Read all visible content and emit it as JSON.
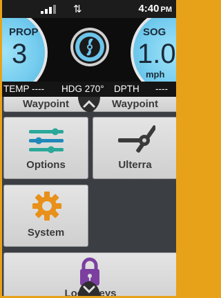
{
  "status": {
    "time": "4:40",
    "ampm": "PM"
  },
  "gauges": {
    "prop": {
      "label": "PROP",
      "value": "3"
    },
    "sog": {
      "label": "SOG",
      "value": "1.0",
      "unit": "mph"
    }
  },
  "info": {
    "temp": "TEMP ----",
    "hdg": "HDG 270°",
    "depth_label": "DPTH",
    "depth_value": "----"
  },
  "tiles": {
    "waypoint_left": "Waypoint",
    "waypoint_right": "Waypoint",
    "options": "Options",
    "ulterra": "Ulterra",
    "system": "System",
    "lock_keys": "Lock Keys"
  },
  "colors": {
    "accent_orange": "#e8901a",
    "gauge_blue": "#76cdef",
    "options_teal": "#2aa89a",
    "lock_purple": "#7b3fa0"
  }
}
